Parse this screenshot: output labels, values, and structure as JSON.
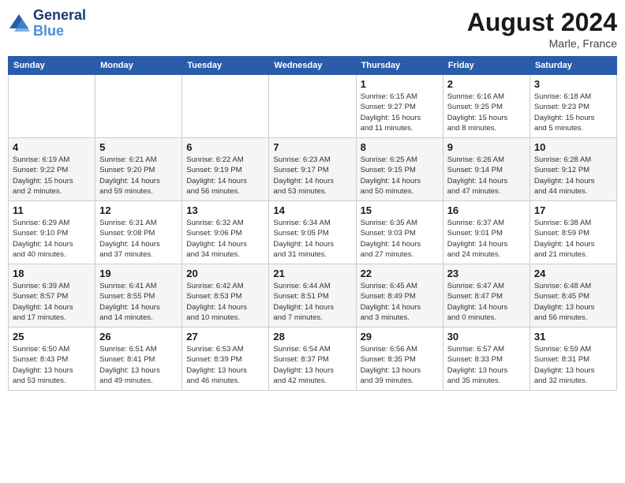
{
  "header": {
    "logo_line1": "General",
    "logo_line2": "Blue",
    "month": "August 2024",
    "location": "Marle, France"
  },
  "weekdays": [
    "Sunday",
    "Monday",
    "Tuesday",
    "Wednesday",
    "Thursday",
    "Friday",
    "Saturday"
  ],
  "weeks": [
    [
      {
        "day": "",
        "info": ""
      },
      {
        "day": "",
        "info": ""
      },
      {
        "day": "",
        "info": ""
      },
      {
        "day": "",
        "info": ""
      },
      {
        "day": "1",
        "info": "Sunrise: 6:15 AM\nSunset: 9:27 PM\nDaylight: 15 hours\nand 11 minutes."
      },
      {
        "day": "2",
        "info": "Sunrise: 6:16 AM\nSunset: 9:25 PM\nDaylight: 15 hours\nand 8 minutes."
      },
      {
        "day": "3",
        "info": "Sunrise: 6:18 AM\nSunset: 9:23 PM\nDaylight: 15 hours\nand 5 minutes."
      }
    ],
    [
      {
        "day": "4",
        "info": "Sunrise: 6:19 AM\nSunset: 9:22 PM\nDaylight: 15 hours\nand 2 minutes."
      },
      {
        "day": "5",
        "info": "Sunrise: 6:21 AM\nSunset: 9:20 PM\nDaylight: 14 hours\nand 59 minutes."
      },
      {
        "day": "6",
        "info": "Sunrise: 6:22 AM\nSunset: 9:19 PM\nDaylight: 14 hours\nand 56 minutes."
      },
      {
        "day": "7",
        "info": "Sunrise: 6:23 AM\nSunset: 9:17 PM\nDaylight: 14 hours\nand 53 minutes."
      },
      {
        "day": "8",
        "info": "Sunrise: 6:25 AM\nSunset: 9:15 PM\nDaylight: 14 hours\nand 50 minutes."
      },
      {
        "day": "9",
        "info": "Sunrise: 6:26 AM\nSunset: 9:14 PM\nDaylight: 14 hours\nand 47 minutes."
      },
      {
        "day": "10",
        "info": "Sunrise: 6:28 AM\nSunset: 9:12 PM\nDaylight: 14 hours\nand 44 minutes."
      }
    ],
    [
      {
        "day": "11",
        "info": "Sunrise: 6:29 AM\nSunset: 9:10 PM\nDaylight: 14 hours\nand 40 minutes."
      },
      {
        "day": "12",
        "info": "Sunrise: 6:31 AM\nSunset: 9:08 PM\nDaylight: 14 hours\nand 37 minutes."
      },
      {
        "day": "13",
        "info": "Sunrise: 6:32 AM\nSunset: 9:06 PM\nDaylight: 14 hours\nand 34 minutes."
      },
      {
        "day": "14",
        "info": "Sunrise: 6:34 AM\nSunset: 9:05 PM\nDaylight: 14 hours\nand 31 minutes."
      },
      {
        "day": "15",
        "info": "Sunrise: 6:35 AM\nSunset: 9:03 PM\nDaylight: 14 hours\nand 27 minutes."
      },
      {
        "day": "16",
        "info": "Sunrise: 6:37 AM\nSunset: 9:01 PM\nDaylight: 14 hours\nand 24 minutes."
      },
      {
        "day": "17",
        "info": "Sunrise: 6:38 AM\nSunset: 8:59 PM\nDaylight: 14 hours\nand 21 minutes."
      }
    ],
    [
      {
        "day": "18",
        "info": "Sunrise: 6:39 AM\nSunset: 8:57 PM\nDaylight: 14 hours\nand 17 minutes."
      },
      {
        "day": "19",
        "info": "Sunrise: 6:41 AM\nSunset: 8:55 PM\nDaylight: 14 hours\nand 14 minutes."
      },
      {
        "day": "20",
        "info": "Sunrise: 6:42 AM\nSunset: 8:53 PM\nDaylight: 14 hours\nand 10 minutes."
      },
      {
        "day": "21",
        "info": "Sunrise: 6:44 AM\nSunset: 8:51 PM\nDaylight: 14 hours\nand 7 minutes."
      },
      {
        "day": "22",
        "info": "Sunrise: 6:45 AM\nSunset: 8:49 PM\nDaylight: 14 hours\nand 3 minutes."
      },
      {
        "day": "23",
        "info": "Sunrise: 6:47 AM\nSunset: 8:47 PM\nDaylight: 14 hours\nand 0 minutes."
      },
      {
        "day": "24",
        "info": "Sunrise: 6:48 AM\nSunset: 8:45 PM\nDaylight: 13 hours\nand 56 minutes."
      }
    ],
    [
      {
        "day": "25",
        "info": "Sunrise: 6:50 AM\nSunset: 8:43 PM\nDaylight: 13 hours\nand 53 minutes."
      },
      {
        "day": "26",
        "info": "Sunrise: 6:51 AM\nSunset: 8:41 PM\nDaylight: 13 hours\nand 49 minutes."
      },
      {
        "day": "27",
        "info": "Sunrise: 6:53 AM\nSunset: 8:39 PM\nDaylight: 13 hours\nand 46 minutes."
      },
      {
        "day": "28",
        "info": "Sunrise: 6:54 AM\nSunset: 8:37 PM\nDaylight: 13 hours\nand 42 minutes."
      },
      {
        "day": "29",
        "info": "Sunrise: 6:56 AM\nSunset: 8:35 PM\nDaylight: 13 hours\nand 39 minutes."
      },
      {
        "day": "30",
        "info": "Sunrise: 6:57 AM\nSunset: 8:33 PM\nDaylight: 13 hours\nand 35 minutes."
      },
      {
        "day": "31",
        "info": "Sunrise: 6:59 AM\nSunset: 8:31 PM\nDaylight: 13 hours\nand 32 minutes."
      }
    ]
  ]
}
